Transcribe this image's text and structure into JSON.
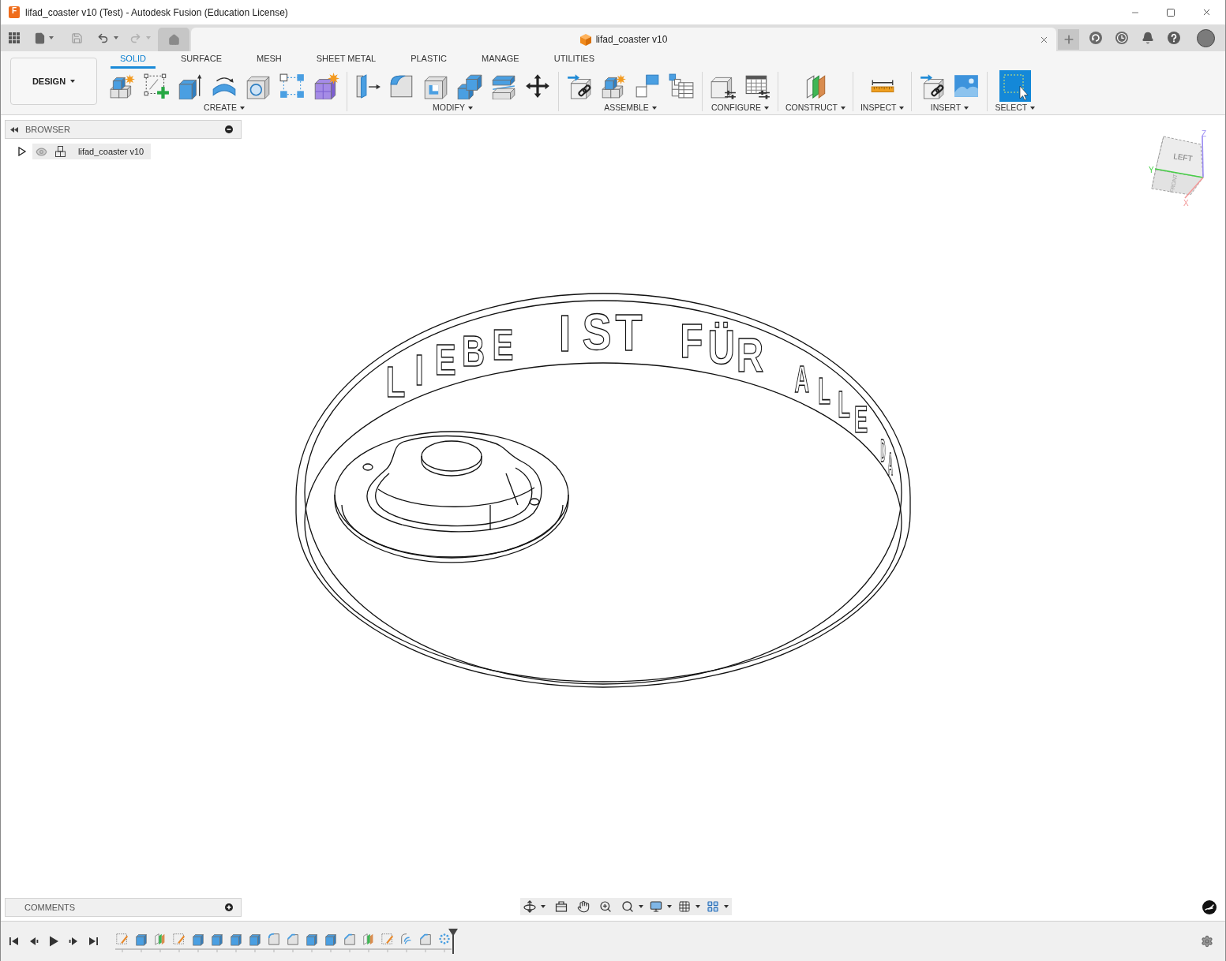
{
  "window": {
    "app_icon_letter": "F",
    "title": "lifad_coaster v10 (Test) - Autodesk Fusion (Education License)"
  },
  "document_tab": {
    "title": "lifad_coaster v10"
  },
  "workspace_switcher": {
    "label": "DESIGN"
  },
  "toolbar_tabs": [
    {
      "label": "SOLID",
      "selected": true
    },
    {
      "label": "SURFACE",
      "selected": false
    },
    {
      "label": "MESH",
      "selected": false
    },
    {
      "label": "SHEET METAL",
      "selected": false
    },
    {
      "label": "PLASTIC",
      "selected": false
    },
    {
      "label": "MANAGE",
      "selected": false
    },
    {
      "label": "UTILITIES",
      "selected": false
    }
  ],
  "tool_groups": [
    {
      "label": "CREATE",
      "tools": [
        {
          "kind": "component"
        },
        {
          "kind": "sketch"
        },
        {
          "kind": "extrude"
        },
        {
          "kind": "revolve"
        },
        {
          "kind": "hole"
        },
        {
          "kind": "pattern"
        },
        {
          "kind": "form"
        }
      ]
    },
    {
      "label": "MODIFY",
      "tools": [
        {
          "kind": "presspull"
        },
        {
          "kind": "fillet"
        },
        {
          "kind": "shell"
        },
        {
          "kind": "combine"
        },
        {
          "kind": "offset"
        },
        {
          "kind": "move"
        }
      ]
    },
    {
      "label": "ASSEMBLE",
      "tools": [
        {
          "kind": "joint"
        },
        {
          "kind": "newcomponent"
        },
        {
          "kind": "origin"
        },
        {
          "kind": "table"
        }
      ]
    },
    {
      "label": "CONFIGURE",
      "tools": [
        {
          "kind": "parameter"
        },
        {
          "kind": "configtable"
        }
      ]
    },
    {
      "label": "CONSTRUCT",
      "tools": [
        {
          "kind": "plane"
        }
      ]
    },
    {
      "label": "INSPECT",
      "tools": [
        {
          "kind": "measure"
        }
      ]
    },
    {
      "label": "INSERT",
      "tools": [
        {
          "kind": "derive"
        },
        {
          "kind": "canvas"
        }
      ]
    },
    {
      "label": "SELECT",
      "tools": [
        {
          "kind": "select"
        }
      ]
    }
  ],
  "browser": {
    "title": "BROWSER",
    "items": [
      {
        "label": "lifad_coaster v10",
        "expanded": false
      }
    ]
  },
  "model": {
    "engraved_words": [
      "LIEBE",
      "IST",
      "FÜR",
      "ALLE",
      "DA"
    ]
  },
  "view_cube": {
    "faces": [
      "LEFT",
      "FRONT"
    ],
    "axes": [
      "Z",
      "Y",
      "X"
    ]
  },
  "comments": {
    "title": "COMMENTS"
  },
  "timeline": {
    "features": [
      {
        "kind": "sketch"
      },
      {
        "kind": "extrude"
      },
      {
        "kind": "plane"
      },
      {
        "kind": "sketch"
      },
      {
        "kind": "extrude"
      },
      {
        "kind": "extrude"
      },
      {
        "kind": "extrude"
      },
      {
        "kind": "extrude"
      },
      {
        "kind": "fillet"
      },
      {
        "kind": "chamfer"
      },
      {
        "kind": "extrude"
      },
      {
        "kind": "extrude"
      },
      {
        "kind": "chamfer"
      },
      {
        "kind": "plane"
      },
      {
        "kind": "sketch"
      },
      {
        "kind": "text"
      },
      {
        "kind": "chamfer"
      },
      {
        "kind": "pattern"
      }
    ]
  }
}
